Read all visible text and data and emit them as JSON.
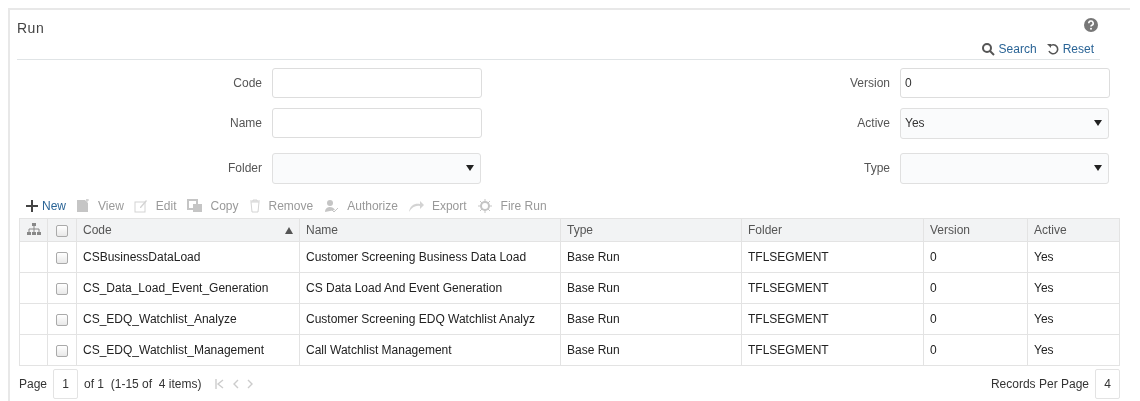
{
  "window": {
    "title": "Run"
  },
  "header_actions": [
    {
      "kind": "search",
      "label": "Search"
    },
    {
      "kind": "reset",
      "label": "Reset"
    }
  ],
  "form": {
    "left": [
      {
        "label": "Code",
        "kind": "text"
      },
      {
        "label": "Name",
        "kind": "text"
      },
      {
        "label": "Folder",
        "kind": "select"
      }
    ],
    "right": [
      {
        "label": "Version",
        "kind": "text",
        "value": "0"
      },
      {
        "label": "Active",
        "kind": "select",
        "value": "Yes"
      },
      {
        "label": "Type",
        "kind": "select"
      }
    ]
  },
  "toolbar": [
    {
      "kind": "new",
      "label": "New",
      "disabled": false
    },
    {
      "kind": "view",
      "label": "View",
      "disabled": true
    },
    {
      "kind": "edit",
      "label": "Edit",
      "disabled": true
    },
    {
      "kind": "copy",
      "label": "Copy",
      "disabled": true
    },
    {
      "kind": "remove",
      "label": "Remove",
      "disabled": true
    },
    {
      "kind": "authorize",
      "label": "Authorize",
      "disabled": true
    },
    {
      "kind": "export",
      "label": "Export",
      "disabled": true
    },
    {
      "kind": "fire",
      "label": "Fire Run",
      "disabled": true
    }
  ],
  "table": {
    "select_all": {
      "checked": false
    },
    "columns": [
      {
        "label": "Code",
        "sorted": true
      },
      {
        "label": "Name",
        "sorted": false
      },
      {
        "label": "Type",
        "sorted": false
      },
      {
        "label": "Folder",
        "sorted": false
      },
      {
        "label": "Version",
        "sorted": false
      },
      {
        "label": "Active",
        "sorted": false
      }
    ],
    "rows": [
      {
        "checked": false,
        "cells": [
          "CSBusinessDataLoad",
          "Customer Screening Business Data Load",
          "Base Run",
          "TFLSEGMENT",
          "0",
          "Yes"
        ]
      },
      {
        "checked": false,
        "cells": [
          "CS_Data_Load_Event_Generation",
          "CS Data Load And Event Generation",
          "Base Run",
          "TFLSEGMENT",
          "0",
          "Yes"
        ]
      },
      {
        "checked": false,
        "cells": [
          "CS_EDQ_Watchlist_Analyze",
          "Customer Screening EDQ Watchlist Analyz",
          "Base Run",
          "TFLSEGMENT",
          "0",
          "Yes"
        ]
      },
      {
        "checked": false,
        "cells": [
          "CS_EDQ_Watchlist_Management",
          "Call Watchlist Management",
          "Base Run",
          "TFLSEGMENT",
          "0",
          "Yes"
        ]
      }
    ]
  },
  "pager": {
    "page_label": "Page",
    "page": "1",
    "summary": "of 1  (1-15 of  4 items)",
    "records_label": "Records Per Page",
    "records": "4"
  }
}
